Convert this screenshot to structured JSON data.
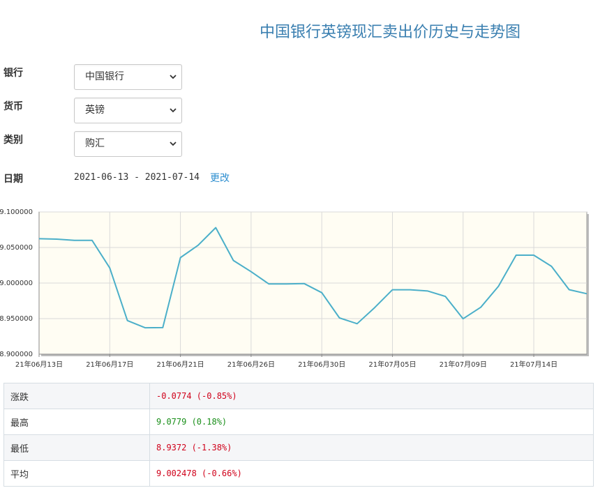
{
  "page": {
    "title": "中国银行英镑现汇卖出价历史与走势图"
  },
  "form": {
    "bank": {
      "label": "银行",
      "value": "中国银行"
    },
    "currency": {
      "label": "货币",
      "value": "英镑"
    },
    "category": {
      "label": "类别",
      "value": "购汇"
    },
    "date": {
      "label": "日期",
      "range": "2021-06-13 - 2021-07-14",
      "change_link": "更改"
    }
  },
  "chart_data": {
    "type": "line",
    "ylim": [
      8.9,
      9.1
    ],
    "y_ticks": [
      "9.100000",
      "9.050000",
      "9.000000",
      "8.950000",
      "8.900000"
    ],
    "y_tick_values": [
      9.1,
      9.05,
      9.0,
      8.95,
      8.9
    ],
    "x_tick_labels": [
      "21年06月13日",
      "21年06月17日",
      "21年06月21日",
      "21年06月26日",
      "21年06月30日",
      "21年07月05日",
      "21年07月09日",
      "21年07月14日"
    ],
    "x_tick_index": [
      0,
      4,
      8,
      12,
      16,
      20,
      24,
      28
    ],
    "grid": true,
    "line_color": "#4bafc9",
    "background": "#fffdf3",
    "series": [
      {
        "values": [
          9.0624,
          9.0618,
          9.0601,
          9.06,
          9.0213,
          8.9473,
          8.9372,
          8.9374,
          9.0358,
          9.0531,
          9.0779,
          9.0318,
          9.016,
          8.9988,
          8.9988,
          8.9993,
          8.9865,
          8.951,
          8.9428,
          8.9656,
          8.9906,
          8.9906,
          8.9888,
          8.9812,
          8.9498,
          8.966,
          8.9955,
          9.0392,
          9.0392,
          9.0235,
          8.9907,
          8.985
        ]
      }
    ]
  },
  "stats": [
    {
      "label": "涨跌",
      "value": "-0.0774 (-0.85%)",
      "color": "#d0021b"
    },
    {
      "label": "最高",
      "value": "9.0779 (0.18%)",
      "color": "#1a8f1a"
    },
    {
      "label": "最低",
      "value": "8.9372 (-1.38%)",
      "color": "#d0021b"
    },
    {
      "label": "平均",
      "value": "9.002478 (-0.66%)",
      "color": "#d0021b"
    }
  ]
}
